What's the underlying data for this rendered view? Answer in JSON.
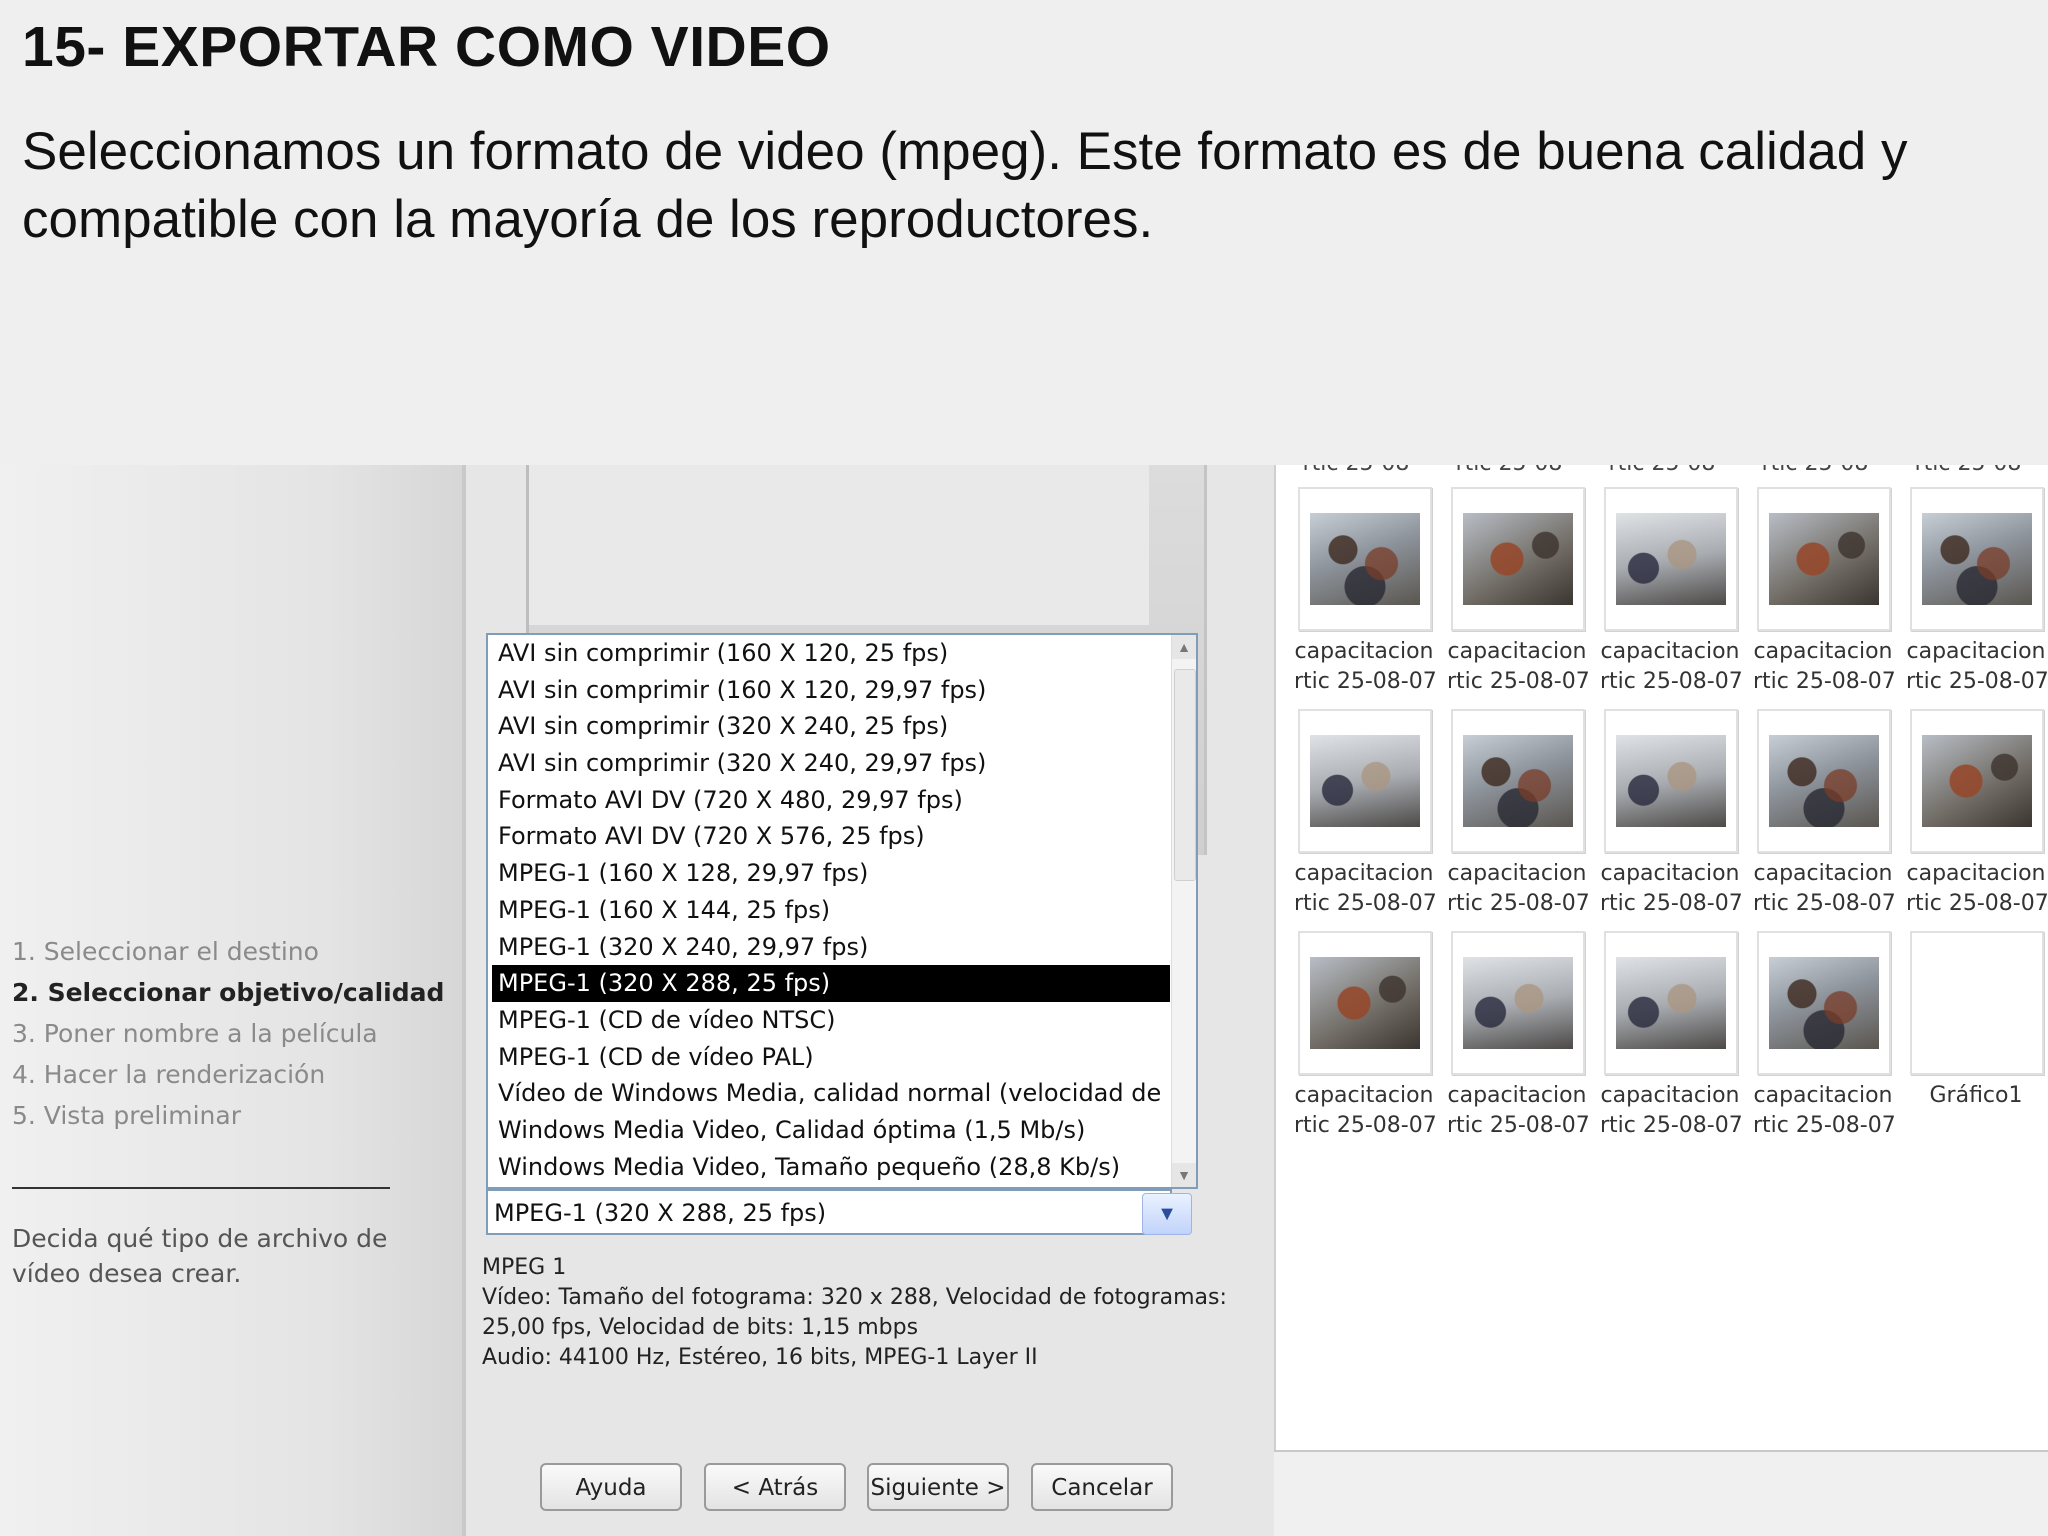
{
  "slide": {
    "title": "15- EXPORTAR COMO VIDEO",
    "body": "Seleccionamos un formato de video (mpeg). Este formato es de buena calidad y compatible con la mayoría de los reproductores."
  },
  "wizard": {
    "steps": [
      {
        "label": "1. Seleccionar el destino",
        "active": false
      },
      {
        "label": "2. Seleccionar objetivo/calidad",
        "active": true
      },
      {
        "label": "3. Poner nombre a la película",
        "active": false
      },
      {
        "label": "4. Hacer la renderización",
        "active": false
      },
      {
        "label": "5. Vista preliminar",
        "active": false
      }
    ],
    "help_text": "Decida qué tipo de archivo de vídeo desea crear.",
    "format_options": [
      "AVI sin comprimir (160 X 120, 25 fps)",
      "AVI sin comprimir (160 X 120, 29,97 fps)",
      "AVI sin comprimir (320 X 240, 25 fps)",
      "AVI sin comprimir (320 X 240, 29,97 fps)",
      "Formato AVI DV (720 X 480, 29,97 fps)",
      "Formato AVI DV (720 X 576, 25 fps)",
      "MPEG-1 (160 X 128, 29,97 fps)",
      "MPEG-1 (160 X 144, 25 fps)",
      "MPEG-1 (320 X 240, 29,97 fps)",
      "MPEG-1 (320 X 288, 25 fps)",
      "MPEG-1 (CD de vídeo NTSC)",
      "MPEG-1 (CD de vídeo PAL)",
      "Vídeo de Windows Media, calidad normal (velocidad de bits variat",
      "Windows Media Video, Calidad óptima (1,5 Mb/s)",
      "Windows Media Video, Tamaño pequeño (28,8 Kb/s)"
    ],
    "selected_index": 9,
    "selected_format": "MPEG-1 (320 X 288, 25 fps)",
    "details": {
      "line1": "MPEG 1",
      "line2": "Vídeo: Tamaño del fotograma: 320 x 288, Velocidad de fotogramas:",
      "line3": "25,00 fps, Velocidad de bits: 1,15 mbps",
      "line4": "Audio: 44100 Hz, Estéreo, 16 bits, MPEG-1 Layer II"
    },
    "buttons": {
      "help": "Ayuda",
      "back": "< Atrás",
      "next": "Siguiente >",
      "cancel": "Cancelar"
    }
  },
  "collection": {
    "clipped_label": "rtic 25-08-07",
    "tiles": [
      {
        "line1": "capacitacion",
        "line2": "rtic 25-08-07",
        "photo": "v1"
      },
      {
        "line1": "capacitacion",
        "line2": "rtic 25-08-07",
        "photo": "v2"
      },
      {
        "line1": "capacitacion",
        "line2": "rtic 25-08-07",
        "photo": "v3"
      },
      {
        "line1": "capacitacion",
        "line2": "rtic 25-08-07",
        "photo": "v2"
      },
      {
        "line1": "capacitacion",
        "line2": "rtic 25-08-07",
        "photo": "v1"
      },
      {
        "line1": "capacitacion",
        "line2": "rtic 25-08-07",
        "photo": "v3"
      },
      {
        "line1": "capacitacion",
        "line2": "rtic 25-08-07",
        "photo": "v1"
      },
      {
        "line1": "capacitacion",
        "line2": "rtic 25-08-07",
        "photo": "v3"
      },
      {
        "line1": "capacitacion",
        "line2": "rtic 25-08-07",
        "photo": "v1"
      },
      {
        "line1": "capacitacion",
        "line2": "rtic 25-08-07",
        "photo": "v2"
      },
      {
        "line1": "capacitacion",
        "line2": "rtic 25-08-07",
        "photo": "v2"
      },
      {
        "line1": "capacitacion",
        "line2": "rtic 25-08-07",
        "photo": "v3"
      },
      {
        "line1": "capacitacion",
        "line2": "rtic 25-08-07",
        "photo": "v3"
      },
      {
        "line1": "capacitacion",
        "line2": "rtic 25-08-07",
        "photo": "v1"
      },
      {
        "line1": "Gráfico1",
        "line2": "",
        "photo": "none"
      }
    ]
  }
}
